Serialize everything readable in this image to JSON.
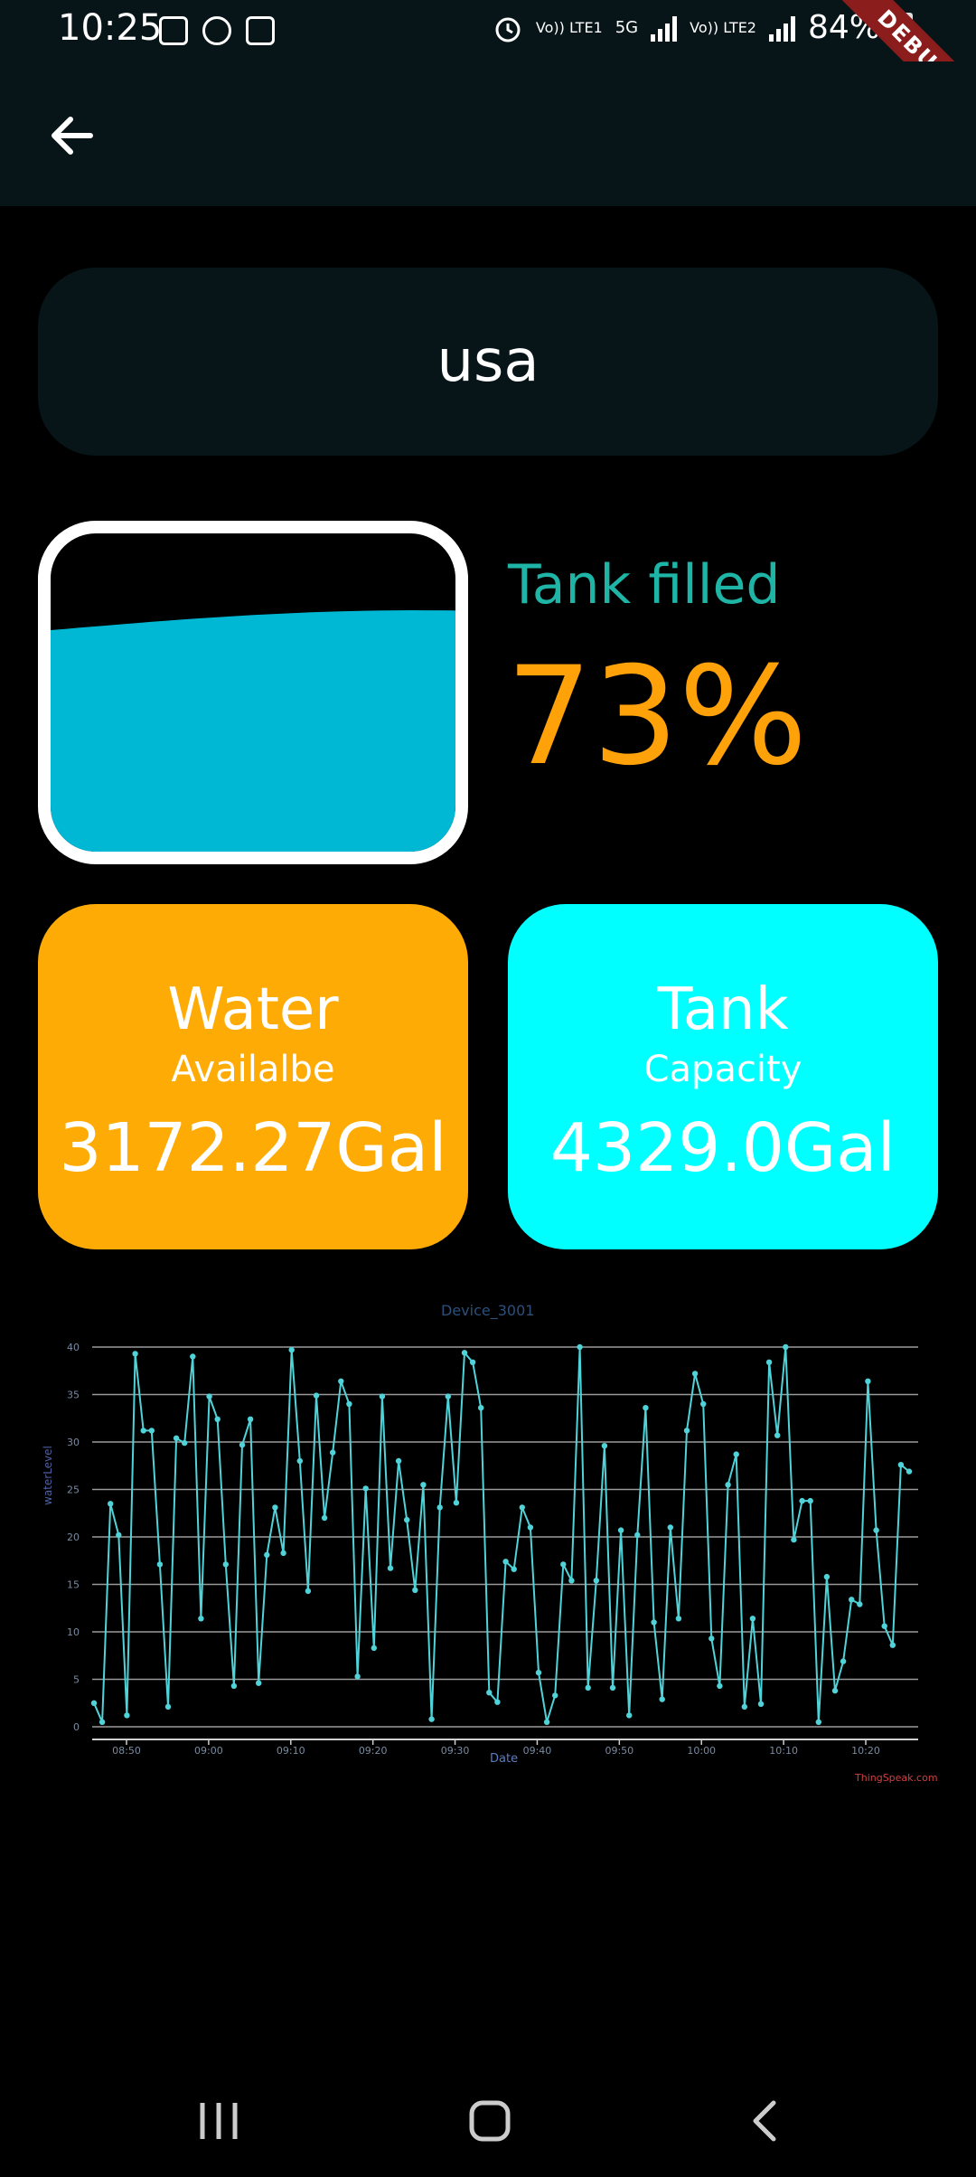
{
  "status_bar": {
    "time": "10:25",
    "net1": "Vo)) LTE1",
    "net_5g": "5G",
    "net2": "Vo)) LTE2",
    "battery": "84%",
    "debug": "DEBUG",
    "icons": [
      "gallery-icon",
      "heart-rate-icon",
      "clock-app-icon",
      "alarm-icon",
      "signal-icon",
      "battery-icon"
    ]
  },
  "app_bar": {
    "back_icon": "arrow-left-icon"
  },
  "device": {
    "name": "usa"
  },
  "tank": {
    "label": "Tank filled",
    "percent": "73%",
    "fill_level": 0.73,
    "water_color": "#00b8d4"
  },
  "cards": {
    "water": {
      "title": "Water",
      "subtitle": "Availalbe",
      "value": "3172.27Gal",
      "color": "#ffab06"
    },
    "capacity": {
      "title": "Tank",
      "subtitle": "Capacity",
      "value": "4329.0Gal",
      "color": "#00ffff"
    }
  },
  "chart_data": {
    "type": "line",
    "title": "Device_3001",
    "xlabel": "Date",
    "ylabel": "waterLevel",
    "credit": "ThingSpeak.com",
    "ylim": [
      0,
      40
    ],
    "yticks": [
      0,
      5,
      10,
      15,
      20,
      25,
      30,
      35,
      40
    ],
    "xticks": [
      "08:50",
      "09:00",
      "09:10",
      "09:20",
      "09:30",
      "09:40",
      "09:50",
      "10:00",
      "10:10",
      "10:20"
    ],
    "grid": true,
    "line_color": "#4fd3d8",
    "series": [
      {
        "values": [
          2.5,
          0.5,
          23.5,
          20.2,
          1.2,
          39.3,
          31.2,
          31.2,
          17.1,
          2.1,
          30.4,
          29.9,
          39.0,
          11.4,
          34.8,
          32.4,
          17.1,
          4.3,
          29.7,
          32.4,
          4.6,
          18.1,
          23.1,
          18.3,
          39.7,
          28.0,
          14.3,
          34.9,
          22.0,
          28.9,
          36.4,
          34.0,
          5.3,
          25.1,
          8.3,
          34.8,
          16.7,
          28.0,
          21.8,
          14.4,
          25.5,
          0.8,
          23.1,
          34.8,
          23.6,
          39.4,
          38.4,
          33.6,
          3.6,
          2.6,
          17.4,
          16.6,
          23.1,
          21.0,
          5.7,
          0.5,
          3.3,
          17.1,
          15.4,
          40.0,
          4.1,
          15.4,
          29.6,
          4.1,
          20.7,
          1.2,
          20.2,
          33.6,
          11.0,
          2.9,
          21.0,
          11.4,
          31.2,
          37.2,
          34.0,
          9.3,
          4.3,
          25.5,
          28.7,
          2.1,
          11.4,
          2.4,
          38.4,
          30.7,
          40.0,
          19.7,
          23.8,
          23.8,
          0.5,
          15.8,
          3.8,
          6.9,
          13.4,
          12.9,
          36.4,
          20.7,
          10.6,
          8.6,
          27.6,
          26.9
        ]
      }
    ]
  },
  "nav_bar": {
    "icons": [
      "recent-apps-icon",
      "home-icon",
      "back-icon"
    ]
  }
}
